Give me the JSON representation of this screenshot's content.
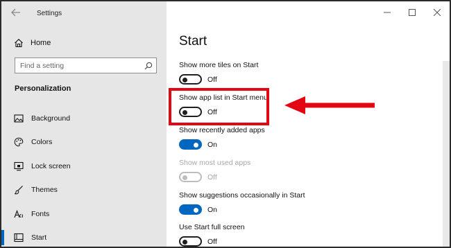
{
  "window": {
    "title": "Settings"
  },
  "sidebar": {
    "home_label": "Home",
    "search_placeholder": "Find a setting",
    "section_heading": "Personalization",
    "items": [
      {
        "label": "Background",
        "icon": "picture-icon"
      },
      {
        "label": "Colors",
        "icon": "palette-icon"
      },
      {
        "label": "Lock screen",
        "icon": "lock-screen-icon"
      },
      {
        "label": "Themes",
        "icon": "brush-icon"
      },
      {
        "label": "Fonts",
        "icon": "font-icon"
      },
      {
        "label": "Start",
        "icon": "start-icon",
        "active": true
      }
    ]
  },
  "main": {
    "title": "Start",
    "settings": [
      {
        "title": "Show more tiles on Start",
        "state": "Off",
        "on": false,
        "disabled": false
      },
      {
        "title": "Show app list in Start menu",
        "state": "Off",
        "on": false,
        "disabled": false
      },
      {
        "title": "Show recently added apps",
        "state": "On",
        "on": true,
        "disabled": false
      },
      {
        "title": "Show most used apps",
        "state": "Off",
        "on": false,
        "disabled": true
      },
      {
        "title": "Show suggestions occasionally in Start",
        "state": "On",
        "on": true,
        "disabled": false
      },
      {
        "title": "Use Start full screen",
        "state": "Off",
        "on": false,
        "disabled": false
      }
    ]
  },
  "colors": {
    "accent": "#0067c0",
    "annotation": "#e30613"
  }
}
